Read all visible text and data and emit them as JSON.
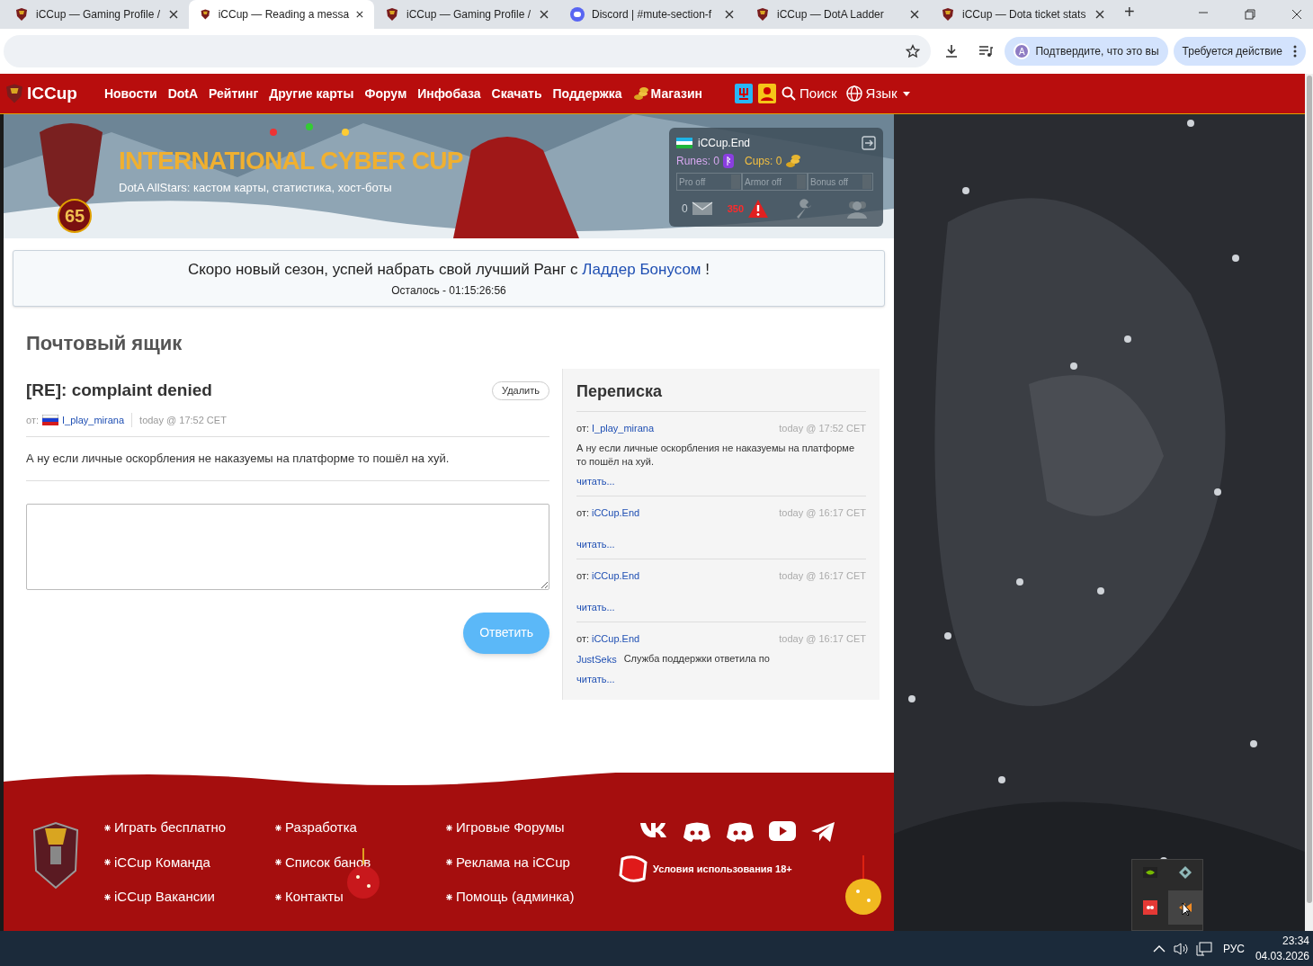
{
  "browser": {
    "tabs": [
      {
        "title": "iCCup — Gaming Profile /",
        "kind": "site",
        "selected": false
      },
      {
        "title": "iCCup — Reading a messa",
        "kind": "site",
        "selected": true
      },
      {
        "title": "iCCup — Gaming Profile /",
        "kind": "site",
        "selected": false
      },
      {
        "title": "Discord | #mute-section-f",
        "kind": "discord",
        "selected": false
      },
      {
        "title": "iCCup — DotA Ladder",
        "kind": "site",
        "selected": false
      },
      {
        "title": "iCCup — Dota ticket stats",
        "kind": "site",
        "selected": false
      }
    ],
    "new_tab": "+",
    "pills": [
      {
        "kind": "account",
        "label": "Подтвердите, что это вы",
        "avatar": "A"
      },
      {
        "kind": "action",
        "label": "Требуется действие"
      }
    ]
  },
  "site": {
    "logo": "ICCup",
    "nav": [
      {
        "label": "Новости",
        "kind": "link"
      },
      {
        "label": "DotA",
        "kind": "link"
      },
      {
        "label": "Рейтинг",
        "kind": "link"
      },
      {
        "label": "Другие карты",
        "kind": "link"
      },
      {
        "label": "Форум",
        "kind": "link"
      },
      {
        "label": "Инфобаза",
        "kind": "link"
      },
      {
        "label": "Скачать",
        "kind": "link"
      },
      {
        "label": "Поддержка",
        "kind": "link"
      },
      {
        "label": "Магазин",
        "kind": "shop"
      }
    ],
    "search": "Поиск",
    "language": "Язык"
  },
  "banner": {
    "title": "INTERNATIONAL CYBER CUP",
    "subtitle": "DotA AllStars: кастом карты, статистика, хост-боты",
    "badge": "65"
  },
  "user_panel": {
    "name": "iCCup.End",
    "runes": "Runes: 0",
    "cups": "Cups: 0",
    "toggles": [
      {
        "label": "Pro off",
        "on": false
      },
      {
        "label": "Armor off",
        "on": false
      },
      {
        "label": "Bonus off",
        "on": false
      }
    ],
    "mail_count": "0",
    "warnings": "350"
  },
  "notice": {
    "text": "Скоро новый сезон, успей набрать свой лучший Ранг с",
    "link": "Ладдер Бонусом",
    "suffix": "!",
    "countdown": "Осталось - 01:15:26:56"
  },
  "mailbox": {
    "heading": "Почтовый ящик",
    "subject": "[RE]: complaint denied",
    "delete": "Удалить",
    "from_label": "от:",
    "sender": "I_play_mirana",
    "time": "today @ 17:52 CET",
    "body": "А ну если личные оскорбления не наказуемы на платформе то пошёл на хуй.",
    "reply": "Ответить"
  },
  "thread": {
    "heading": "Переписка",
    "items": [
      {
        "from_label": "от:",
        "sender": "I_play_mirana",
        "time": "today @ 17:52 CET",
        "body": "А ну если личные оскорбления не наказуемы на платформе то пошёл на хуй.",
        "read_more": "читать..."
      },
      {
        "from_label": "от:",
        "sender": "iCCup.End",
        "time": "today @ 16:17 CET",
        "read_more": "читать..."
      },
      {
        "from_label": "от:",
        "sender": "iCCup.End",
        "time": "today @ 16:17 CET",
        "read_more": "читать..."
      },
      {
        "from_label": "от:",
        "sender": "iCCup.End",
        "time": "today @ 16:17 CET",
        "body_link": "JustSeks",
        "body": "Служба поддержки ответила по",
        "read_more": "читать..."
      }
    ]
  },
  "footer": {
    "columns": [
      [
        "Играть бесплатно",
        "iCCup Команда",
        "iCCup Вакансии"
      ],
      [
        "Разработка",
        "Список банов",
        "Контакты"
      ],
      [
        "Игровые Форумы",
        "Реклама на iCCup",
        "Помощь (админка)"
      ]
    ],
    "terms": "Условия использования 18+"
  },
  "taskbar": {
    "language": "РУС",
    "time": "23:34",
    "date": "04.03.2026"
  }
}
